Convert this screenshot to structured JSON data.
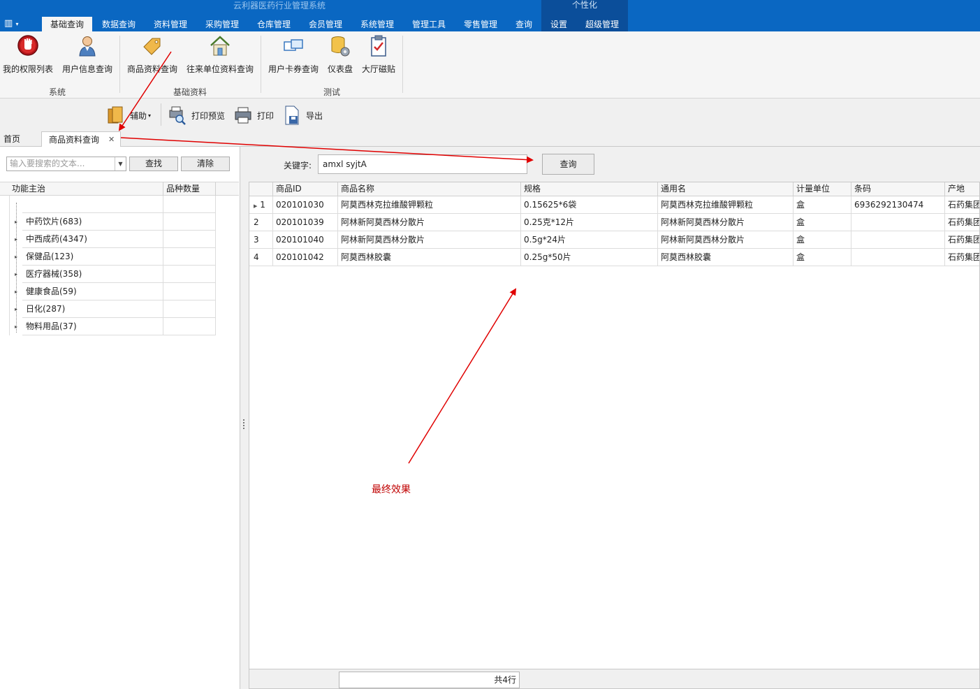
{
  "window": {
    "title": "云利器医药行业管理系统",
    "context_group": "个性化"
  },
  "ribbon_tabs": [
    "基础查询",
    "数据查询",
    "资料管理",
    "采购管理",
    "仓库管理",
    "会员管理",
    "系统管理",
    "管理工具",
    "零售管理",
    "查询",
    "设置",
    "超级管理"
  ],
  "ribbon": {
    "buttons": [
      "我的权限列表",
      "用户信息查询",
      "商品资料查询",
      "往来单位资料查询",
      "用户卡券查询",
      "仪表盘",
      "大厅磁贴"
    ],
    "groups": [
      "系统",
      "基础资料",
      "测试"
    ]
  },
  "toolbar": {
    "assist": "辅助",
    "print_preview": "打印预览",
    "print": "打印",
    "export": "导出"
  },
  "doc_tabs": {
    "home": "首页",
    "active": "商品资料查询",
    "close": "✕"
  },
  "left": {
    "search_placeholder": "输入要搜索的文本...",
    "find_label": "查找",
    "clear_label": "清除",
    "col1": "功能主治",
    "col2": "品种数量",
    "items": [
      "中药饮片(683)",
      "中西成药(4347)",
      "保健品(123)",
      "医疗器械(358)",
      "健康食品(59)",
      "日化(287)",
      "物料用品(37)"
    ]
  },
  "right": {
    "keyword_label": "关键字:",
    "keyword_value": "amxl syjtA",
    "query_label": "查询",
    "columns": [
      "商品ID",
      "商品名称",
      "规格",
      "通用名",
      "计量单位",
      "条码",
      "产地"
    ],
    "rows": [
      {
        "no": "1",
        "id": "020101030",
        "name": "阿莫西林克拉维酸钾颗粒",
        "spec": "0.15625*6袋",
        "generic": "阿莫西林克拉维酸钾颗粒",
        "unit": "盒",
        "barcode": "6936292130474",
        "origin": "石药集团"
      },
      {
        "no": "2",
        "id": "020101039",
        "name": "阿林新阿莫西林分散片",
        "spec": "0.25克*12片",
        "generic": "阿林新阿莫西林分散片",
        "unit": "盒",
        "barcode": "",
        "origin": "石药集团"
      },
      {
        "no": "3",
        "id": "020101040",
        "name": "阿林新阿莫西林分散片",
        "spec": "0.5g*24片",
        "generic": "阿林新阿莫西林分散片",
        "unit": "盒",
        "barcode": "",
        "origin": "石药集团"
      },
      {
        "no": "4",
        "id": "020101042",
        "name": "阿莫西林胶囊",
        "spec": "0.25g*50片",
        "generic": "阿莫西林胶囊",
        "unit": "盒",
        "barcode": "",
        "origin": "石药集团"
      }
    ],
    "row_count": "共4行"
  },
  "annotation": {
    "note": "最终效果",
    "color": "#e00000"
  }
}
